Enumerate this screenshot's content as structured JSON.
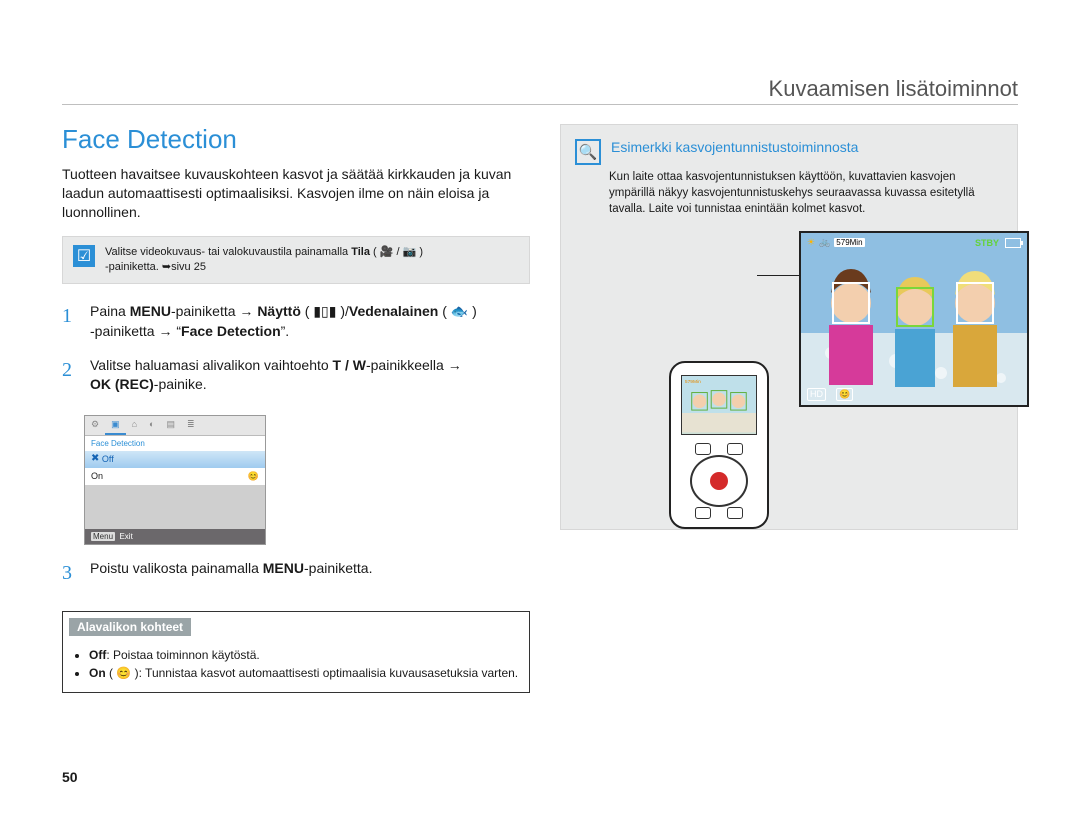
{
  "chapter_title": "Kuvaamisen lisätoiminnot",
  "page_number": "50",
  "left": {
    "heading": "Face Detection",
    "lead": "Tuotteen havaitsee kuvauskohteen kasvot ja säätää kirkkauden ja kuvan laadun automaattisesti optimaalisiksi. Kasvojen ilme on näin eloisa ja luonnollinen.",
    "note": {
      "icon": "☑",
      "prefix": "Valitse videokuvaus- tai valokuvaustila painamalla ",
      "bold": "Tila",
      "modes": " ( 🎥 / 📷 )",
      "suffix": " -painiketta. ➥sivu 25"
    },
    "steps": {
      "s1_pre": "Paina ",
      "s1_menu": "MENU",
      "s1_mid": "-painiketta → ",
      "s1_disp": "Näyttö",
      "s1_disp_icon": " ( ▮▯▮ )/",
      "s1_under": "Vedenalainen",
      "s1_under_icon": " ( 🐟 )",
      "s1_tail": " -painiketta → “",
      "s1_fd": "Face Detection",
      "s1_end": "”.",
      "s2_pre": "Valitse haluamasi alivalikon vaihtoehto ",
      "s2_tw": "T / W",
      "s2_mid": "-painikkeella → ",
      "s2_ok": "OK (REC)",
      "s2_end": "-painike.",
      "s3_pre": "Poistu valikosta painamalla ",
      "s3_menu": "MENU",
      "s3_end": "-painiketta."
    },
    "menu_shot": {
      "title": "Face Detection",
      "off_marker": "✖",
      "off": "Off",
      "on": "On",
      "on_icon": "😊",
      "footer_key": "Menu",
      "footer_label": "Exit"
    },
    "submenu": {
      "header": "Alavalikon kohteet",
      "off_l": "Off",
      "off_t": ": Poistaa toiminnon käytöstä.",
      "on_l": "On",
      "on_icon": " ( 😊 )",
      "on_t": ": Tunnistaa kasvot automaattisesti optimaalisia kuvausasetuksia varten."
    }
  },
  "right": {
    "icon": "🔍",
    "title": "Esimerkki kasvojentunnistustoiminnosta",
    "desc": "Kun laite ottaa kasvojentunnistuksen käyttöön, kuvattavien kasvojen ympärillä näkyy kasvojentunnistuskehys seuraavassa kuvassa esitetyllä tavalla. Laite voi tunnistaa enintään kolmet kasvot.",
    "osd": {
      "sun": "☀",
      "bike": "🚲",
      "time": "579Min",
      "stby": "STBY",
      "hd": "HD",
      "face": "😊"
    }
  }
}
